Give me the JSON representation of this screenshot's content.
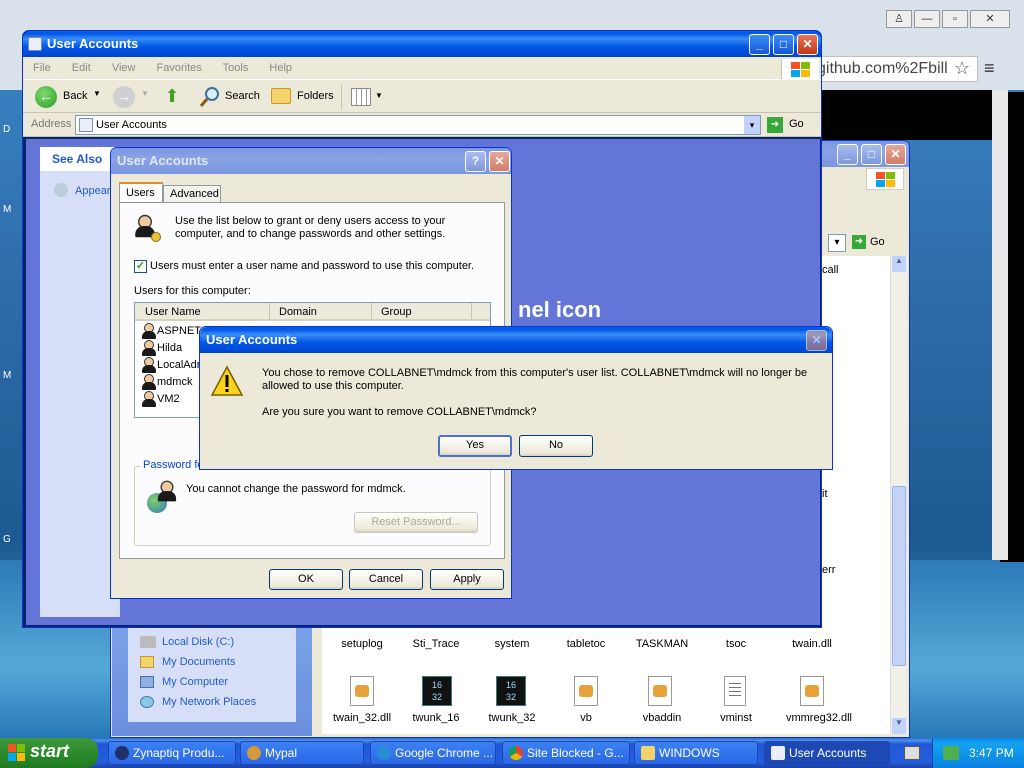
{
  "chrome_bg": {
    "omnibox_text": "github.com%2Fbill",
    "controls": [
      "♙",
      "—",
      "▫",
      "✕"
    ]
  },
  "desktop_letters": [
    "D",
    "M",
    "M",
    "G"
  ],
  "main_window": {
    "title": "User Accounts",
    "menu": [
      "File",
      "Edit",
      "View",
      "Favorites",
      "Tools",
      "Help"
    ],
    "toolbar": {
      "back": "Back",
      "search": "Search",
      "folders": "Folders"
    },
    "address_label": "Address",
    "address_value": "User Accounts",
    "go": "Go",
    "see_also": "See Also",
    "see_also_item": "Appear",
    "panel_text": "nel icon"
  },
  "back_window": {
    "go": "Go",
    "side_links": [
      "Local Disk (C:)",
      "My Documents",
      "My Computer",
      "My Network Places"
    ],
    "right_fragments": [
      "call",
      "it",
      "err"
    ],
    "files_row1": [
      "setuplog",
      "Sti_Trace",
      "system",
      "tabletoc",
      "TASKMAN",
      "tsoc",
      "twain.dll"
    ],
    "files_row2": [
      "twain_32.dll",
      "twunk_16",
      "twunk_32",
      "vb",
      "vbaddin",
      "vminst",
      "vmmreg32.dll"
    ],
    "icon_num_top": "16",
    "icon_num_bottom": "32"
  },
  "ua_dialog": {
    "title": "User Accounts",
    "tabs": [
      "Users",
      "Advanced"
    ],
    "intro": "Use the list below to grant or deny users access to your computer, and to change passwords and other settings.",
    "checkbox_label": "Users must enter a user name and password to use this computer.",
    "list_label": "Users for this computer:",
    "columns": [
      "User Name",
      "Domain",
      "Group"
    ],
    "users": [
      "ASPNET",
      "Hilda",
      "LocalAdr",
      "mdmck",
      "VM2"
    ],
    "password_group": "Password fo",
    "password_text": "You cannot change the password for mdmck.",
    "reset_button": "Reset Password...",
    "ok": "OK",
    "cancel": "Cancel",
    "apply": "Apply"
  },
  "confirm": {
    "title": "User Accounts",
    "message": "You chose to remove COLLABNET\\mdmck from this computer's user list. COLLABNET\\mdmck will no longer be allowed to use this computer.",
    "question": "Are you sure you want to remove COLLABNET\\mdmck?",
    "yes": "Yes",
    "no": "No"
  },
  "taskbar": {
    "start": "start",
    "items": [
      "Zynaptiq Produ...",
      "Mypal",
      "Google Chrome ...",
      "Site Blocked - G...",
      "WINDOWS",
      "User Accounts"
    ],
    "clock": "3:47 PM"
  },
  "colors": {
    "xp_blue": "#0058e6",
    "panel_blue": "#6375d6",
    "start_green": "#2f8d2f",
    "close_red": "#c33516"
  }
}
